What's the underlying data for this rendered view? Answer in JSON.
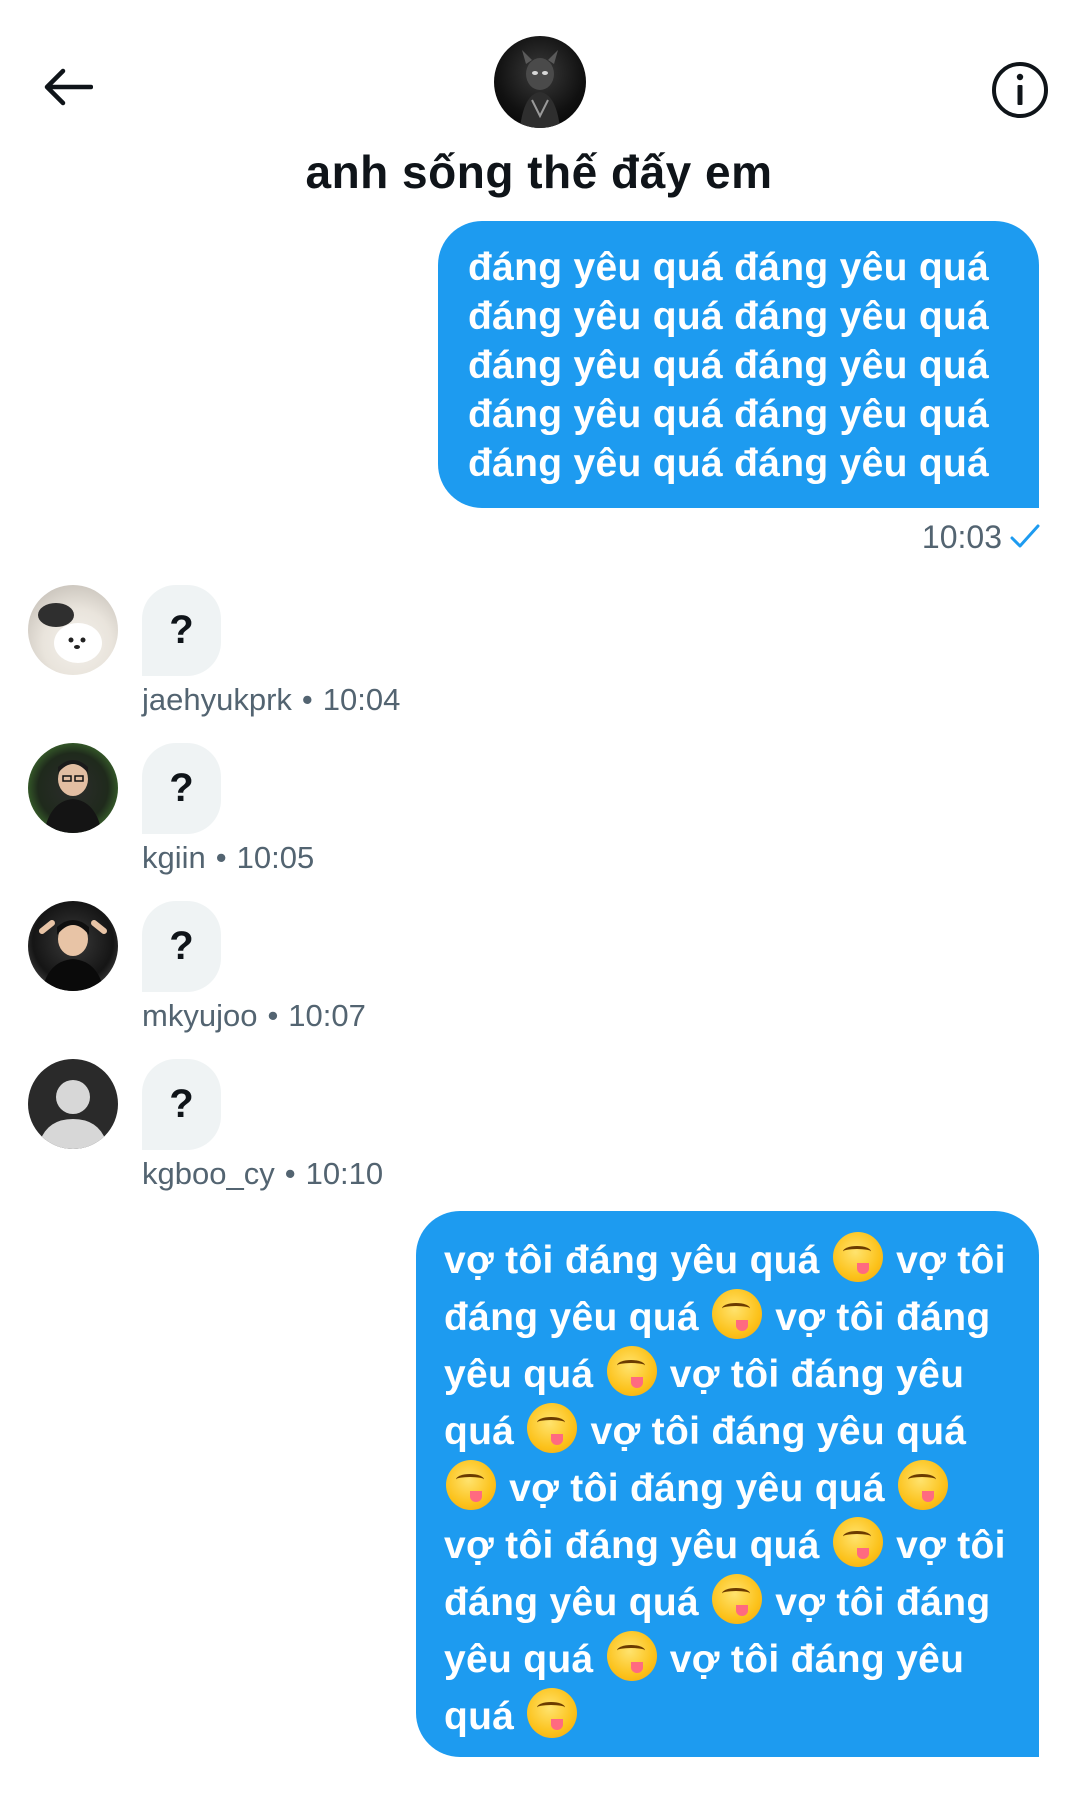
{
  "header": {
    "title": "anh sống thế đấy em",
    "back_icon": "arrow-left-icon",
    "info_icon": "info-circle-icon"
  },
  "messages": [
    {
      "lines": [
        "đáng yêu quá đáng yêu quá",
        "đáng yêu quá đáng yêu quá",
        "đáng yêu quá đáng yêu quá",
        "đáng yêu quá đáng yêu quá",
        "đáng yêu quá đáng yêu quá"
      ],
      "time": "10:03",
      "status_icon": "checkmark-icon"
    },
    {
      "lines": [
        [
          "vợ tôi đáng yêu quá",
          "emoji",
          "vợ tôi"
        ],
        [
          "đáng yêu quá",
          "emoji",
          "vợ tôi đáng"
        ],
        [
          "yêu quá",
          "emoji",
          "vợ tôi đáng yêu"
        ],
        [
          "quá",
          "emoji",
          "vợ tôi đáng yêu quá"
        ],
        [
          "emoji",
          "vợ tôi đáng yêu quá",
          "emoji"
        ],
        [
          "vợ tôi đáng yêu quá",
          "emoji",
          "vợ tôi"
        ],
        [
          "đáng yêu quá",
          "emoji",
          "vợ tôi đáng"
        ],
        [
          "yêu quá",
          "emoji",
          "vợ tôi đáng yêu"
        ],
        [
          "quá",
          "emoji"
        ]
      ],
      "emoji_icon": "face-savoring-food-emoji"
    }
  ],
  "replies": [
    {
      "text": "?",
      "user": "jaehyukprk",
      "separator": "•",
      "time": "10:04"
    },
    {
      "text": "?",
      "user": "kgiin",
      "separator": "•",
      "time": "10:05"
    },
    {
      "text": "?",
      "user": "mkyujoo",
      "separator": "•",
      "time": "10:07"
    },
    {
      "text": "?",
      "user": "kgboo_cy",
      "separator": "•",
      "time": "10:10"
    }
  ],
  "colors": {
    "accent": "#1d9bf0",
    "incoming_bubble": "#eff3f4",
    "secondary_text": "#536471"
  }
}
